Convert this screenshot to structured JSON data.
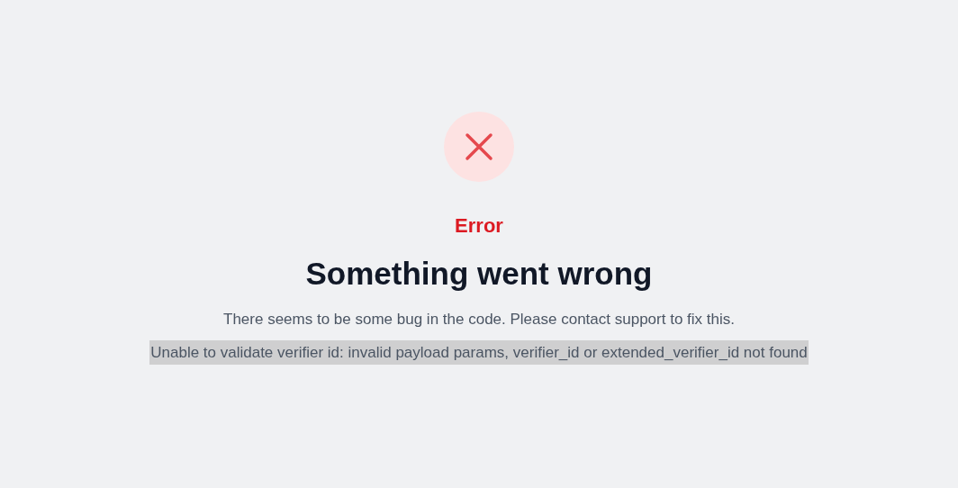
{
  "status": "Error",
  "title": "Something went wrong",
  "message": "There seems to be some bug in the code. Please contact support to fix this.",
  "detail": {
    "text": "Unable to validate verifier id: invalid payload params, verifier_id or extended_verifier_id not found",
    "selected": true
  }
}
